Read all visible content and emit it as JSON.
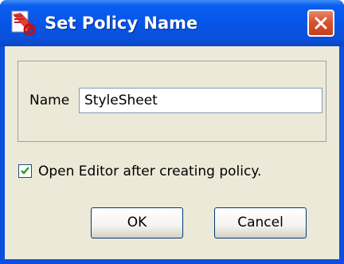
{
  "dialog": {
    "title": "Set Policy Name",
    "app_icon": "policy-icon",
    "close_icon": "close-icon"
  },
  "form": {
    "name_label": "Name",
    "name_value": "StyleSheet"
  },
  "options": {
    "open_editor_label": "Open Editor after creating policy.",
    "open_editor_checked": true
  },
  "buttons": {
    "ok_label": "OK",
    "cancel_label": "Cancel"
  },
  "colors": {
    "titlebar": "#0555e8",
    "close_button": "#d9532f",
    "dialog_background": "#ece9d8",
    "button_border": "#003c74"
  }
}
